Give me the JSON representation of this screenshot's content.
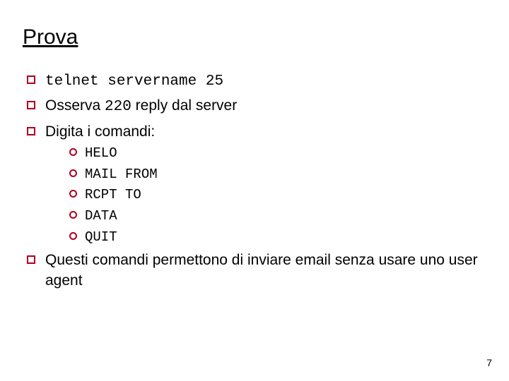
{
  "title": "Prova",
  "bullets": {
    "b1_pre": "",
    "b1_code": "telnet servername 25",
    "b2_pre": "Osserva ",
    "b2_code": "220",
    "b2_post": " reply dal server",
    "b3": "Digita i comandi:",
    "b4": "Questi comandi permettono di inviare email senza usare uno user agent"
  },
  "commands": {
    "c1": "HELO",
    "c2": "MAIL FROM",
    "c3": "RCPT TO",
    "c4": "DATA",
    "c5": "QUIT"
  },
  "page_number": "7"
}
